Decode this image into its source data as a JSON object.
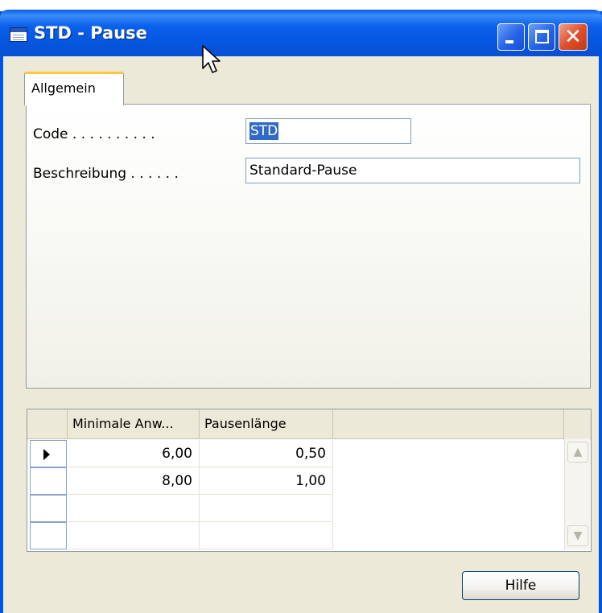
{
  "window": {
    "title": "STD - Pause",
    "title_icon": "form-icon",
    "buttons": {
      "minimize": "minimize-icon",
      "maximize": "maximize-icon",
      "close": "close-icon"
    }
  },
  "tabs": [
    {
      "label": "Allgemein",
      "active": true
    }
  ],
  "form": {
    "code": {
      "label": "Code . . . . . . . . . .",
      "value": "STD",
      "selected": true
    },
    "beschreibung": {
      "label": "Beschreibung . . . . . .",
      "value": "Standard-Pause"
    }
  },
  "table": {
    "columns": [
      "Minimale Anw...",
      "Pausenlänge"
    ],
    "rows": [
      {
        "min_anwesenheit": "6,00",
        "pausenlaenge": "0,50",
        "current": true
      },
      {
        "min_anwesenheit": "8,00",
        "pausenlaenge": "1,00"
      },
      {
        "min_anwesenheit": "",
        "pausenlaenge": ""
      },
      {
        "min_anwesenheit": "",
        "pausenlaenge": ""
      }
    ]
  },
  "footer": {
    "help_button": "Hilfe"
  },
  "colors": {
    "titlebar": "#0055e5",
    "window_bg": "#ece9d8",
    "selection": "#316ac5",
    "tab_highlight": "#ffc83c"
  }
}
